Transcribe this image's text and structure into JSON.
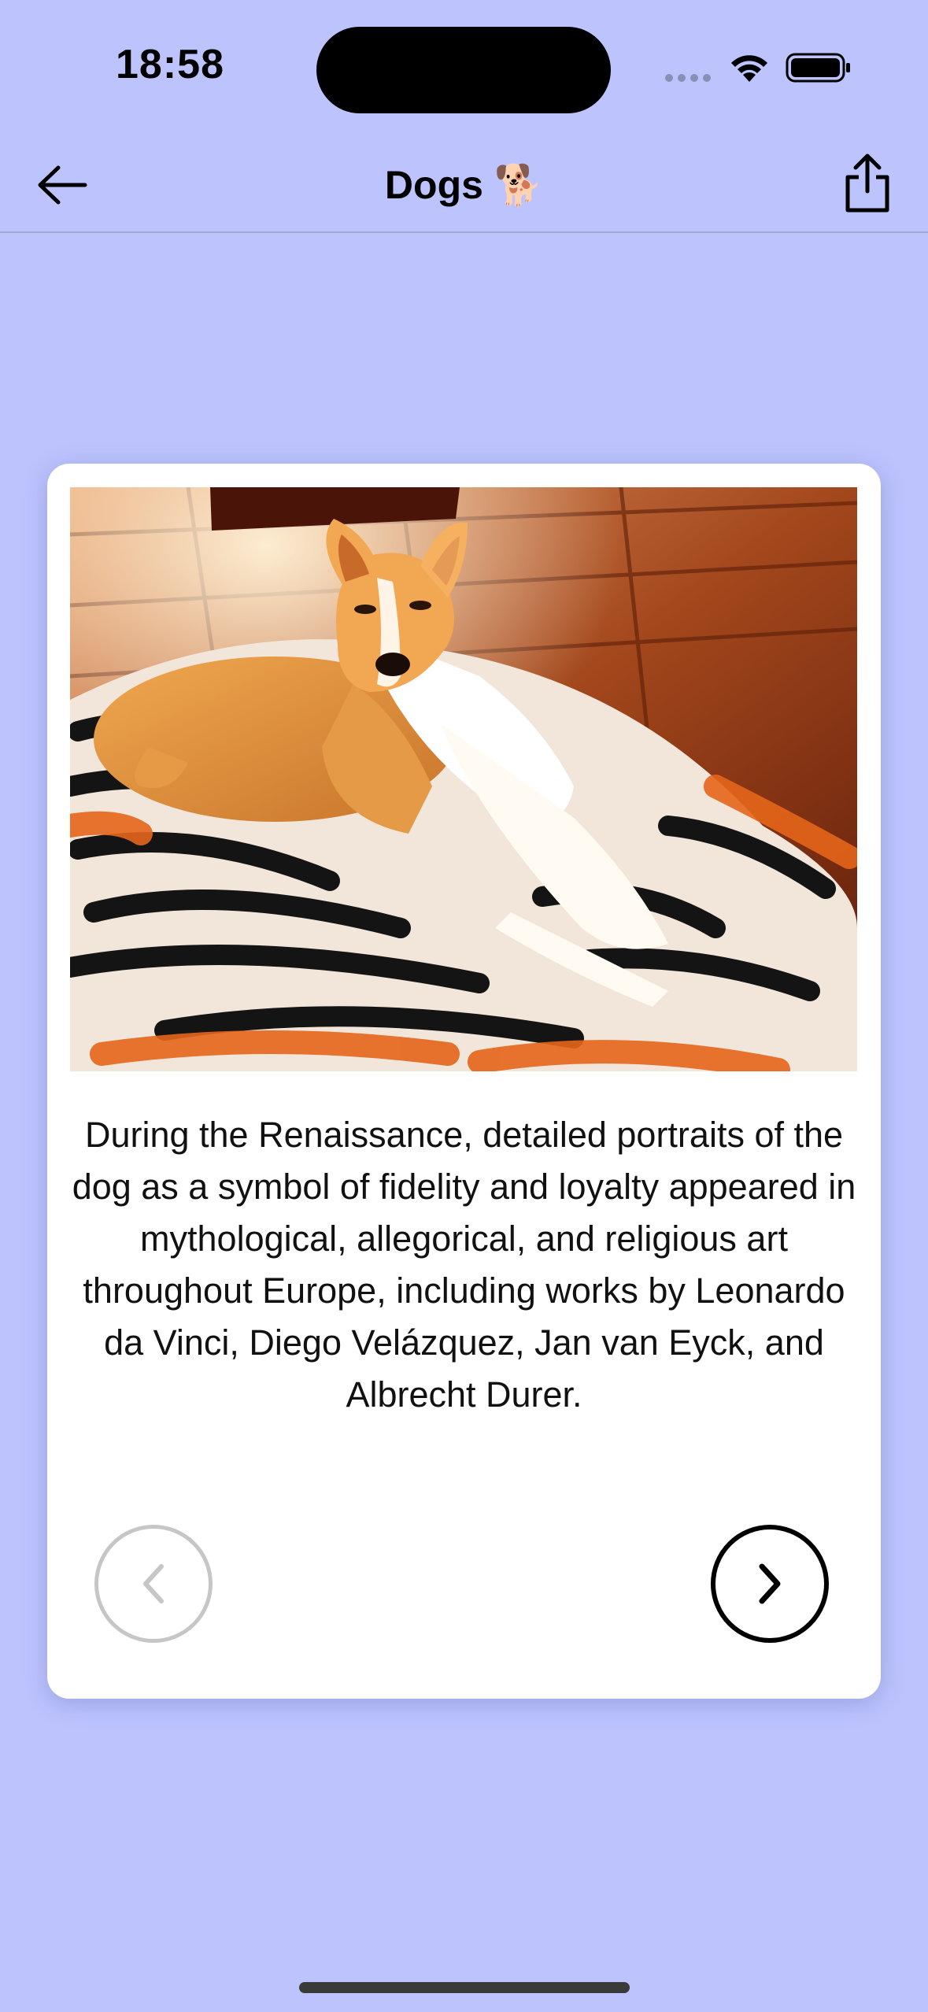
{
  "status_bar": {
    "time": "18:58",
    "icons": [
      "signal-icon",
      "wifi-icon",
      "battery-icon"
    ]
  },
  "nav": {
    "back_icon": "arrow-left-icon",
    "title": "Dogs 🐕",
    "share_icon": "share-icon"
  },
  "card": {
    "image_subject": "dog-photo",
    "fact": "During the Renaissance, detailed portraits of the dog as a symbol of fidelity and loyalty appeared in mythological, allegorical, and religious art throughout Europe, including works by Leonardo da Vinci, Diego Velázquez, Jan van Eyck, and Albrecht Durer.",
    "prev_icon": "chevron-left-icon",
    "next_icon": "chevron-right-icon",
    "prev_enabled": false,
    "next_enabled": true
  },
  "colors": {
    "background": "#bcc3fd",
    "card": "#ffffff",
    "disabled": "#c6c6c6"
  }
}
